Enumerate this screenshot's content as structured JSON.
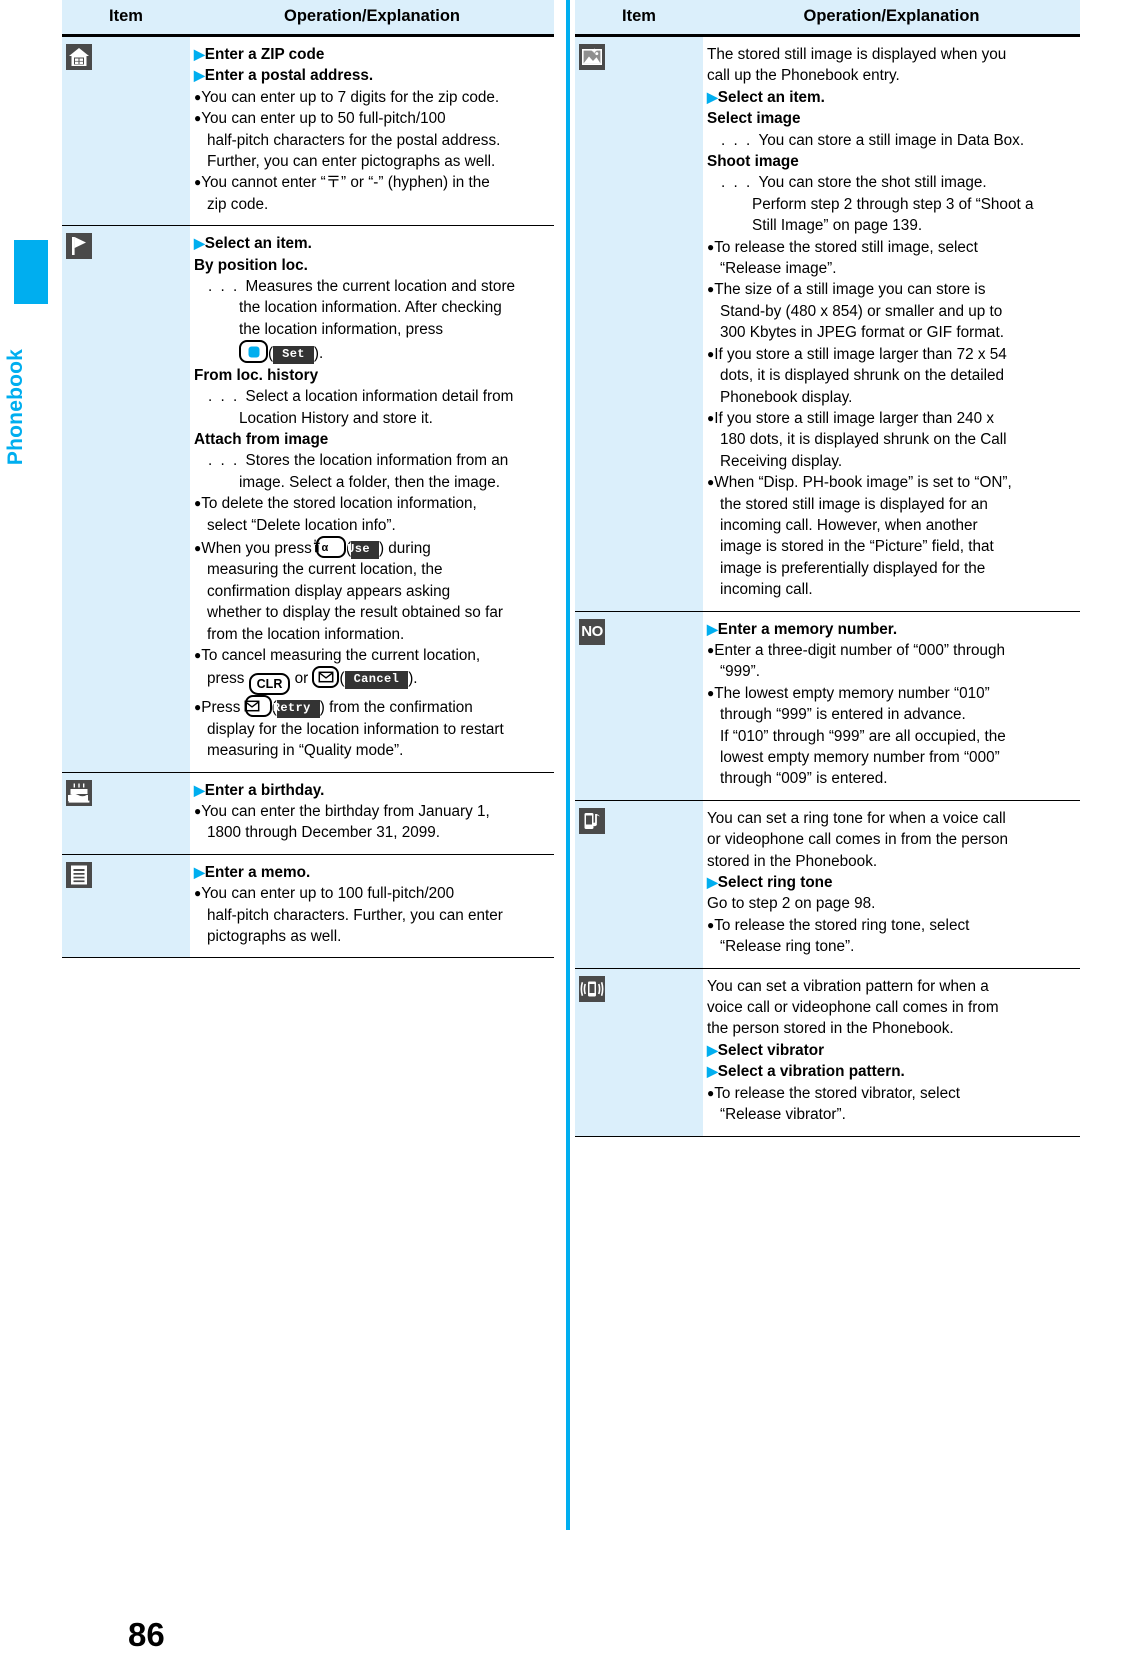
{
  "sidebar": {
    "tab_label": "Phonebook"
  },
  "page_number": "86",
  "table_headers": {
    "item": "Item",
    "operation": "Operation/Explanation"
  },
  "left_column": {
    "rows": [
      {
        "icon": "house-icon",
        "name": "<Address>",
        "lines": [
          {
            "type": "arrow",
            "text": "Enter a ZIP code"
          },
          {
            "type": "arrow",
            "text": "Enter a postal address."
          },
          {
            "type": "bullet",
            "text": "You can enter up to 7 digits for the zip code."
          },
          {
            "type": "bullet",
            "text": "You can enter up to 50 full-pitch/100"
          },
          {
            "type": "cont",
            "text": "half-pitch characters for the postal address."
          },
          {
            "type": "cont",
            "text": "Further, you can enter pictographs as well."
          },
          {
            "type": "bullet",
            "text": "You cannot enter “〒” or “-” (hyphen) in the"
          },
          {
            "type": "cont",
            "text": "zip code."
          }
        ]
      },
      {
        "icon": "flag-icon",
        "name": "<Location information>",
        "lines": [
          {
            "type": "arrow",
            "text": "Select an item."
          },
          {
            "type": "boldhead",
            "text": "By position loc."
          },
          {
            "type": "dots",
            "text": "Measures the current location and store"
          },
          {
            "type": "indent",
            "text": "the location information. After checking"
          },
          {
            "type": "indent",
            "text": "the location information, press"
          },
          {
            "type": "key-set",
            "text": "Set"
          },
          {
            "type": "boldhead",
            "text": "From loc. history"
          },
          {
            "type": "dots",
            "text": "Select a location information detail from"
          },
          {
            "type": "indent",
            "text": "Location History and store it."
          },
          {
            "type": "boldhead",
            "text": "Attach from image"
          },
          {
            "type": "dots",
            "text": "Stores the location information from an"
          },
          {
            "type": "indent",
            "text": "image. Select a folder, then the image."
          },
          {
            "type": "bullet",
            "text": "To delete the stored location information,"
          },
          {
            "type": "cont",
            "text": "select “Delete location info”."
          },
          {
            "type": "key-use",
            "pre": "When you press ",
            "soft": "Use",
            "post": ") during"
          },
          {
            "type": "cont",
            "text": "measuring the current location, the"
          },
          {
            "type": "cont",
            "text": "confirmation display appears asking"
          },
          {
            "type": "cont",
            "text": "whether to display the result obtained so far"
          },
          {
            "type": "cont",
            "text": "from the location information."
          },
          {
            "type": "bullet",
            "text": "To cancel measuring the current location,"
          },
          {
            "type": "key-cancel",
            "pre": "press ",
            "mid": "CLR",
            "conj": " or ",
            "soft": "Cancel",
            "post": ")."
          },
          {
            "type": "key-retry",
            "pre": "Press ",
            "soft": "Retry",
            "post": ") from the confirmation"
          },
          {
            "type": "cont",
            "text": "display for the location information to restart"
          },
          {
            "type": "cont",
            "text": "measuring in “Quality mode”."
          }
        ]
      },
      {
        "icon": "cake-icon",
        "name": "<Birthday>",
        "lines": [
          {
            "type": "arrow",
            "text": "Enter a birthday."
          },
          {
            "type": "bullet",
            "text": "You can enter the birthday from January 1,"
          },
          {
            "type": "cont",
            "text": "1800 through December 31, 2099."
          }
        ]
      },
      {
        "icon": "memo-icon",
        "name": "<Memo>",
        "lines": [
          {
            "type": "arrow",
            "text": "Enter a memo."
          },
          {
            "type": "bullet",
            "text": "You can enter up to 100 full-pitch/200"
          },
          {
            "type": "cont",
            "text": "half-pitch characters. Further, you can enter"
          },
          {
            "type": "cont",
            "text": "pictographs as well."
          }
        ]
      }
    ]
  },
  "right_column": {
    "rows": [
      {
        "icon": "picture-icon",
        "name": "<Image>",
        "lines": [
          {
            "type": "plain",
            "text": "The stored still image is displayed when you"
          },
          {
            "type": "plain",
            "text": "call up the Phonebook entry."
          },
          {
            "type": "arrow",
            "text": "Select an item."
          },
          {
            "type": "boldhead",
            "text": "Select image"
          },
          {
            "type": "dots",
            "text": "You can store a still image in Data Box."
          },
          {
            "type": "boldhead",
            "text": "Shoot image"
          },
          {
            "type": "dots",
            "text": "You can store the shot still image."
          },
          {
            "type": "indent",
            "text": "Perform step 2 through step 3 of “Shoot a"
          },
          {
            "type": "indent",
            "text": "Still Image” on page 139."
          },
          {
            "type": "bullet",
            "text": "To release the stored still image, select"
          },
          {
            "type": "cont",
            "text": "“Release image”."
          },
          {
            "type": "bullet",
            "text": "The size of a still image you can store is"
          },
          {
            "type": "cont",
            "text": "Stand-by (480 x 854) or smaller and up to"
          },
          {
            "type": "cont",
            "text": "300 Kbytes in JPEG format or GIF format."
          },
          {
            "type": "bullet",
            "text": "If you store a still image larger than 72 x 54"
          },
          {
            "type": "cont",
            "text": "dots, it is displayed shrunk on the detailed"
          },
          {
            "type": "cont",
            "text": "Phonebook display."
          },
          {
            "type": "bullet",
            "text": "If you store a still image larger than 240 x"
          },
          {
            "type": "cont",
            "text": "180 dots, it is displayed shrunk on the Call"
          },
          {
            "type": "cont",
            "text": "Receiving display."
          },
          {
            "type": "bullet",
            "text": "When “Disp. PH-book image” is set to “ON”,"
          },
          {
            "type": "cont",
            "text": "the stored still image is displayed for an"
          },
          {
            "type": "cont",
            "text": "incoming call. However, when another"
          },
          {
            "type": "cont",
            "text": "image is stored in the “Picture” field, that"
          },
          {
            "type": "cont",
            "text": "image is preferentially displayed for the"
          },
          {
            "type": "cont",
            "text": "incoming call."
          }
        ]
      },
      {
        "icon": "no-icon",
        "icon_text": "NO",
        "name": "<Memory No.>",
        "lines": [
          {
            "type": "arrow",
            "text": "Enter a memory number."
          },
          {
            "type": "bullet",
            "text": "Enter a three-digit number of “000” through"
          },
          {
            "type": "cont",
            "text": "“999”."
          },
          {
            "type": "bullet",
            "text": "The lowest empty memory number “010”"
          },
          {
            "type": "cont",
            "text": "through “999” is entered in advance."
          },
          {
            "type": "cont",
            "text": "If “010” through “999” are all occupied, the"
          },
          {
            "type": "cont",
            "text": "lowest empty memory number from “000”"
          },
          {
            "type": "cont",
            "text": "through “009” is entered."
          }
        ]
      },
      {
        "icon": "ringtone-icon",
        "name": "<Ring tone>",
        "lines": [
          {
            "type": "plain",
            "text": "You can set a ring tone for when a voice call"
          },
          {
            "type": "plain",
            "text": "or videophone call comes in from the person"
          },
          {
            "type": "plain",
            "text": "stored in the Phonebook."
          },
          {
            "type": "arrow",
            "text": "Select ring tone"
          },
          {
            "type": "plain",
            "text": "Go to step 2 on page 98."
          },
          {
            "type": "bullet",
            "text": "To release the stored ring tone, select"
          },
          {
            "type": "cont",
            "text": "“Release ring tone”."
          }
        ]
      },
      {
        "icon": "vibrator-icon",
        "name": "<Vibrator>",
        "lines": [
          {
            "type": "plain",
            "text": "You can set a vibration pattern for when a"
          },
          {
            "type": "plain",
            "text": "voice call or videophone call comes in from"
          },
          {
            "type": "plain",
            "text": "the person stored in the Phonebook."
          },
          {
            "type": "arrow",
            "text": "Select vibrator"
          },
          {
            "type": "arrow",
            "text": "Select a vibration pattern."
          },
          {
            "type": "bullet",
            "text": "To release the stored vibrator, select"
          },
          {
            "type": "cont",
            "text": "“Release vibrator”."
          }
        ]
      }
    ]
  },
  "colors": {
    "accent": "#00AEEF",
    "item_bg": "#dbeffb",
    "icon_tile": "#4a4a4a"
  }
}
